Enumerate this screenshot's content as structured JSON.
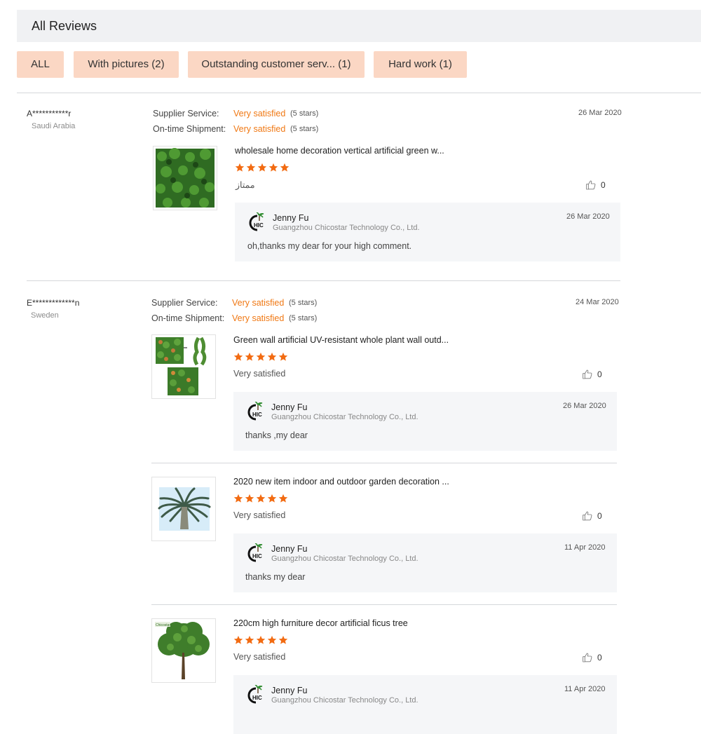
{
  "header": {
    "title": "All Reviews"
  },
  "filters": [
    {
      "label": "ALL"
    },
    {
      "label": "With pictures (2)"
    },
    {
      "label": "Outstanding customer serv... (1)"
    },
    {
      "label": "Hard work (1)"
    }
  ],
  "colors": {
    "accent": "#f07813",
    "chip_bg": "#fbd7c4",
    "star": "#f26b12",
    "reply_bg": "#f5f6f8"
  },
  "reviews": [
    {
      "name": "A***********r",
      "country": "Saudi Arabia",
      "supplier_label": "Supplier Service:",
      "supplier_value": "Very satisfied",
      "supplier_stars": "(5 stars)",
      "shipment_label": "On-time Shipment:",
      "shipment_value": "Very satisfied",
      "shipment_stars": "(5 stars)",
      "date": "26 Mar 2020",
      "products": [
        {
          "title": "wholesale home decoration vertical artificial green w...",
          "rating": 5,
          "text": "ممتاز",
          "likes": "0",
          "reply": {
            "name": "Jenny Fu",
            "company": "Guangzhou Chicostar Technology Co., Ltd.",
            "date": "26 Mar 2020",
            "text": "oh,thanks my dear for your high comment."
          }
        }
      ]
    },
    {
      "name": "E*************n",
      "country": "Sweden",
      "supplier_label": "Supplier Service:",
      "supplier_value": "Very satisfied",
      "supplier_stars": "(5 stars)",
      "shipment_label": "On-time Shipment:",
      "shipment_value": "Very satisfied",
      "shipment_stars": "(5 stars)",
      "date": "24 Mar 2020",
      "products": [
        {
          "title": "Green wall artificial UV-resistant whole plant wall outd...",
          "rating": 5,
          "text": "Very satisfied",
          "likes": "0",
          "reply": {
            "name": "Jenny Fu",
            "company": "Guangzhou Chicostar Technology Co., Ltd.",
            "date": "26 Mar 2020",
            "text": "thanks ,my dear"
          }
        },
        {
          "title": "2020 new item indoor and outdoor garden decoration ...",
          "rating": 5,
          "text": "Very satisfied",
          "likes": "0",
          "reply": {
            "name": "Jenny Fu",
            "company": "Guangzhou Chicostar Technology Co., Ltd.",
            "date": "11 Apr 2020",
            "text": "thanks my dear"
          }
        },
        {
          "title": "220cm high furniture decor artificial ficus tree",
          "rating": 5,
          "text": "Very satisfied",
          "likes": "0",
          "reply": {
            "name": "Jenny Fu",
            "company": "Guangzhou Chicostar Technology Co., Ltd.",
            "date": "11 Apr 2020",
            "text": ""
          }
        }
      ]
    }
  ]
}
